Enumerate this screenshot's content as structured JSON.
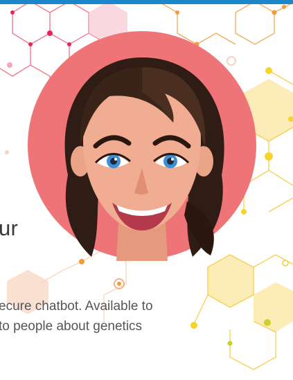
{
  "hero": {
    "heading_fragment": "ur",
    "description_lines": [
      "ecure chatbot. Available to",
      "to people about genetics"
    ]
  },
  "colors": {
    "top_bar": "#1b86c9",
    "avatar_ring": "#ef7478",
    "hex_pink": "#e8245a",
    "hex_orange": "#f39a3a",
    "hex_yellow": "#f6d52a",
    "hex_green": "#c9d12a"
  },
  "icons": [
    "chatbot-avatar-icon",
    "hexagon-molecule-pattern"
  ]
}
